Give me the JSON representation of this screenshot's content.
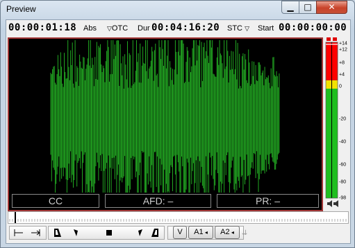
{
  "window": {
    "title": "Preview"
  },
  "timecode": {
    "current": "00:00:01:18",
    "current_mode": "Abs",
    "otc_label": "OTC",
    "dur_label": "Dur",
    "duration": "00:04:16:20",
    "stc_label": "STC",
    "start_label": "Start",
    "start": "00:00:00:00"
  },
  "overlays": {
    "cc": "CC",
    "afd": "AFD: –",
    "pr": "PR: –"
  },
  "meter": {
    "scale": [
      "+14",
      "+12",
      "+8",
      "+4",
      "0",
      "-20",
      "-40",
      "-60",
      "-80",
      "-98"
    ]
  },
  "tracks": {
    "v": "V",
    "a1": "A1",
    "a2": "A2"
  },
  "colors": {
    "waveform": "#22a822",
    "frame": "#a23535"
  }
}
